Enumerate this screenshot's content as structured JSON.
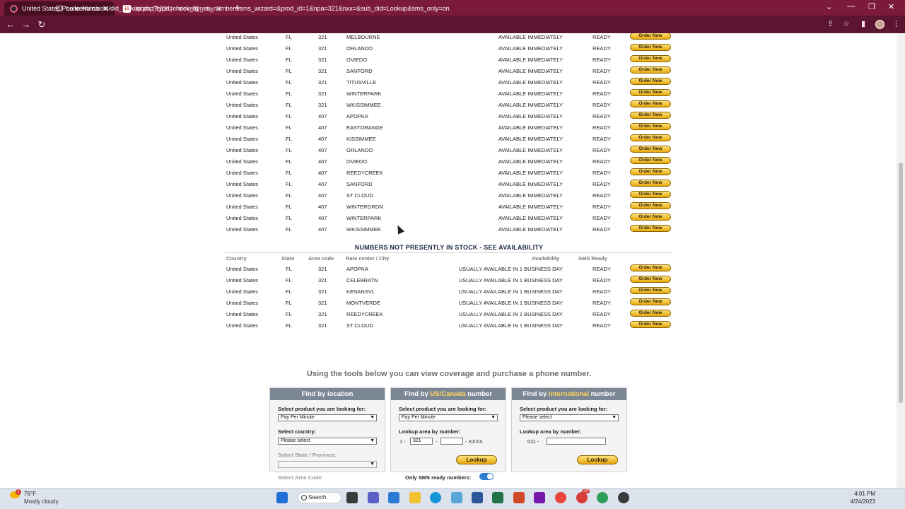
{
  "browser": {
    "tabs": [
      {
        "title": "United States Phone Numbers: D",
        "active": true
      },
      {
        "title": "Inbox (3,531) - steve@networkc",
        "active": false
      }
    ],
    "url": "callcentric.com/did_lookup.php?type=check_by_us_number&sms_wizard=&prod_id=1&npa=321&nxx=&sub_did=Lookup&sms_only=on"
  },
  "instock_rows": [
    {
      "country": "United States",
      "state": "FL",
      "area": "321",
      "city": "MELBOURNE",
      "availability": "AVAILABLE IMMEDIATELY",
      "sms": "READY",
      "order": "Order Now"
    },
    {
      "country": "United States",
      "state": "FL",
      "area": "321",
      "city": "ORLANDO",
      "availability": "AVAILABLE IMMEDIATELY",
      "sms": "READY",
      "order": "Order Now"
    },
    {
      "country": "United States",
      "state": "FL",
      "area": "321",
      "city": "OVIEDO",
      "availability": "AVAILABLE IMMEDIATELY",
      "sms": "READY",
      "order": "Order Now"
    },
    {
      "country": "United States",
      "state": "FL",
      "area": "321",
      "city": "SANFORD",
      "availability": "AVAILABLE IMMEDIATELY",
      "sms": "READY",
      "order": "Order Now"
    },
    {
      "country": "United States",
      "state": "FL",
      "area": "321",
      "city": "TITUSVILLE",
      "availability": "AVAILABLE IMMEDIATELY",
      "sms": "READY",
      "order": "Order Now"
    },
    {
      "country": "United States",
      "state": "FL",
      "area": "321",
      "city": "WINTERPARK",
      "availability": "AVAILABLE IMMEDIATELY",
      "sms": "READY",
      "order": "Order Now"
    },
    {
      "country": "United States",
      "state": "FL",
      "area": "321",
      "city": "WKISSIMMEE",
      "availability": "AVAILABLE IMMEDIATELY",
      "sms": "READY",
      "order": "Order Now"
    },
    {
      "country": "United States",
      "state": "FL",
      "area": "407",
      "city": "APOPKA",
      "availability": "AVAILABLE IMMEDIATELY",
      "sms": "READY",
      "order": "Order Now"
    },
    {
      "country": "United States",
      "state": "FL",
      "area": "407",
      "city": "EASTORANGE",
      "availability": "AVAILABLE IMMEDIATELY",
      "sms": "READY",
      "order": "Order Now"
    },
    {
      "country": "United States",
      "state": "FL",
      "area": "407",
      "city": "KISSIMMEE",
      "availability": "AVAILABLE IMMEDIATELY",
      "sms": "READY",
      "order": "Order Now"
    },
    {
      "country": "United States",
      "state": "FL",
      "area": "407",
      "city": "ORLANDO",
      "availability": "AVAILABLE IMMEDIATELY",
      "sms": "READY",
      "order": "Order Now"
    },
    {
      "country": "United States",
      "state": "FL",
      "area": "407",
      "city": "OVIEDO",
      "availability": "AVAILABLE IMMEDIATELY",
      "sms": "READY",
      "order": "Order Now"
    },
    {
      "country": "United States",
      "state": "FL",
      "area": "407",
      "city": "REEDYCREEK",
      "availability": "AVAILABLE IMMEDIATELY",
      "sms": "READY",
      "order": "Order Now"
    },
    {
      "country": "United States",
      "state": "FL",
      "area": "407",
      "city": "SANFORD",
      "availability": "AVAILABLE IMMEDIATELY",
      "sms": "READY",
      "order": "Order Now"
    },
    {
      "country": "United States",
      "state": "FL",
      "area": "407",
      "city": "ST CLOUD",
      "availability": "AVAILABLE IMMEDIATELY",
      "sms": "READY",
      "order": "Order Now"
    },
    {
      "country": "United States",
      "state": "FL",
      "area": "407",
      "city": "WINTERGRDN",
      "availability": "AVAILABLE IMMEDIATELY",
      "sms": "READY",
      "order": "Order Now"
    },
    {
      "country": "United States",
      "state": "FL",
      "area": "407",
      "city": "WINTERPARK",
      "availability": "AVAILABLE IMMEDIATELY",
      "sms": "READY",
      "order": "Order Now"
    },
    {
      "country": "United States",
      "state": "FL",
      "area": "407",
      "city": "WKISSIMMEE",
      "availability": "AVAILABLE IMMEDIATELY",
      "sms": "READY",
      "order": "Order Now"
    }
  ],
  "not_in_stock": {
    "title": "NUMBERS NOT PRESENTLY IN STOCK - SEE AVAILABILITY",
    "headers": {
      "country": "Country",
      "state": "State",
      "area": "Area code",
      "city": "Rate center / City",
      "availability": "Availability",
      "sms": "SMS Ready"
    },
    "rows": [
      {
        "country": "United States",
        "state": "FL",
        "area": "321",
        "city": "APOPKA",
        "availability": "USUALLY AVAILABLE IN 1 BUSINESS DAY",
        "sms": "READY",
        "order": "Order Now"
      },
      {
        "country": "United States",
        "state": "FL",
        "area": "321",
        "city": "CELEBRATN",
        "availability": "USUALLY AVAILABLE IN 1 BUSINESS DAY",
        "sms": "READY",
        "order": "Order Now"
      },
      {
        "country": "United States",
        "state": "FL",
        "area": "321",
        "city": "KENANSVL",
        "availability": "USUALLY AVAILABLE IN 1 BUSINESS DAY",
        "sms": "READY",
        "order": "Order Now"
      },
      {
        "country": "United States",
        "state": "FL",
        "area": "321",
        "city": "MONTVERDE",
        "availability": "USUALLY AVAILABLE IN 1 BUSINESS DAY",
        "sms": "READY",
        "order": "Order Now"
      },
      {
        "country": "United States",
        "state": "FL",
        "area": "321",
        "city": "REEDYCREEK",
        "availability": "USUALLY AVAILABLE IN 1 BUSINESS DAY",
        "sms": "READY",
        "order": "Order Now"
      },
      {
        "country": "United States",
        "state": "FL",
        "area": "321",
        "city": "ST CLOUD",
        "availability": "USUALLY AVAILABLE IN 1 BUSINESS DAY",
        "sms": "READY",
        "order": "Order Now"
      }
    ]
  },
  "tools": {
    "title": "Using the tools below you can view coverage and purchase a phone number.",
    "location": {
      "heading": "Find by location",
      "product_label": "Select product you are looking for:",
      "product_value": "Pay Per Minute",
      "country_label": "Select country:",
      "country_value": "Please select",
      "state_label": "Select State / Province:",
      "area_label": "Select Area Code:"
    },
    "us": {
      "heading_pre": "Find by ",
      "heading_hl": "US/Canada",
      "heading_post": " number",
      "product_label": "Select product you are looking for:",
      "product_value": "Pay Per Minute",
      "lookup_label": "Lookup area by number:",
      "prefix": "1 -",
      "npa": "321",
      "dash": "-",
      "suffix": "- XXXX",
      "button": "Lookup",
      "sms_label": "Only SMS ready numbers:",
      "sms_on": true
    },
    "intl": {
      "heading_pre": "Find by ",
      "heading_hl": "International",
      "heading_post": " number",
      "product_label": "Select product you are looking for:",
      "product_value": "Please select",
      "lookup_label": "Lookup area by number:",
      "prefix": "011 -",
      "button": "Lookup"
    }
  },
  "taskbar": {
    "temp": "76°F",
    "weather": "Mostly cloudy",
    "weather_badge": "1",
    "search": "Search",
    "time": "4:01 PM",
    "date": "4/24/2023",
    "chrome_badge": "24"
  },
  "colors": {
    "tab_bar": "#7c1a3d",
    "order_button": "#e7a80c",
    "panel_header": "#7c8796"
  }
}
